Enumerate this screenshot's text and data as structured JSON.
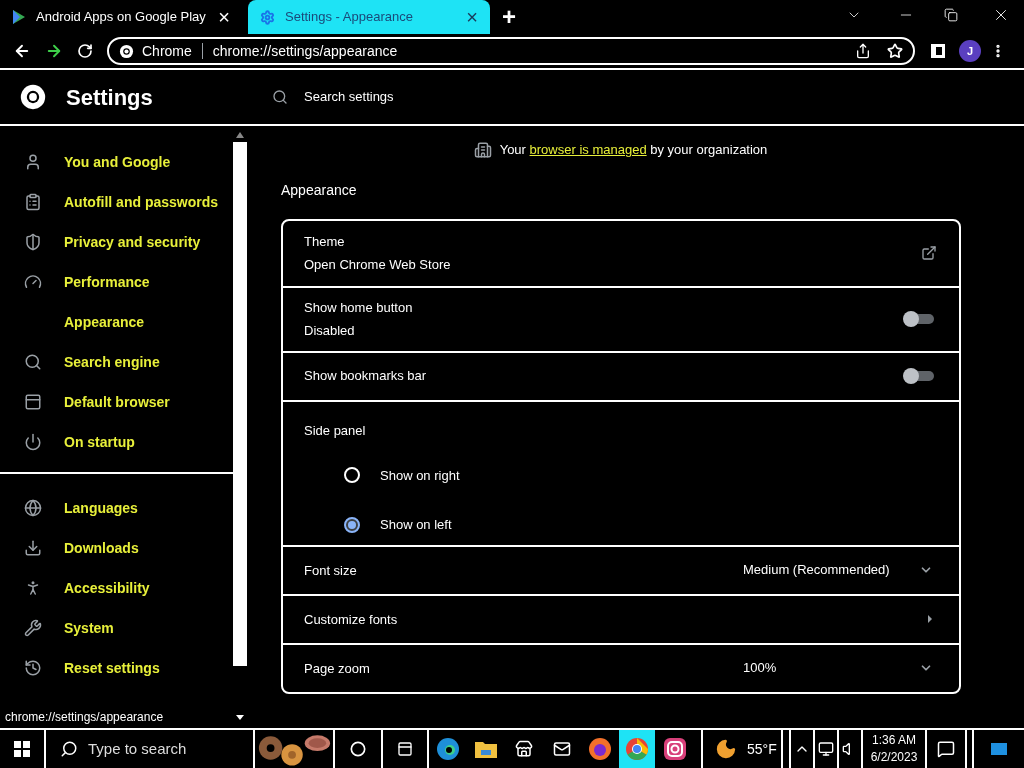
{
  "tabs": [
    {
      "label": "Android Apps on Google Play",
      "close": "×",
      "selected": false
    },
    {
      "label": "Settings - Appearance",
      "close": "×",
      "selected": true
    }
  ],
  "new_tab": "+",
  "address_bar": {
    "site": "Chrome",
    "url": "chrome://settings/appearance"
  },
  "profile": "J",
  "header": {
    "title": "Settings",
    "search_placeholder": "Search settings"
  },
  "sidebar": {
    "groups": [
      [
        {
          "label": "You and Google"
        },
        {
          "label": "Autofill and passwords"
        },
        {
          "label": "Privacy and security"
        },
        {
          "label": "Performance"
        },
        {
          "label": "Appearance"
        },
        {
          "label": "Search engine"
        },
        {
          "label": "Default browser"
        },
        {
          "label": "On startup"
        }
      ],
      [
        {
          "label": "Languages"
        },
        {
          "label": "Downloads"
        },
        {
          "label": "Accessibility"
        },
        {
          "label": "System"
        },
        {
          "label": "Reset settings"
        }
      ]
    ]
  },
  "managed_notice": {
    "before": "Your",
    "link": "browser is managed",
    "after": "by your organization"
  },
  "section_title": "Appearance",
  "rows": [
    {
      "kind": "link",
      "title": "Theme",
      "subtitle": "Open Chrome Web Store"
    },
    {
      "kind": "toggle",
      "title": "Show home button",
      "subtitle": "Disabled",
      "on": false
    },
    {
      "kind": "toggle",
      "title": "Show bookmarks bar",
      "on": false
    },
    {
      "kind": "radio",
      "title": "Side panel",
      "options": [
        {
          "label": "Show on right",
          "selected": false
        },
        {
          "label": "Show on left",
          "selected": true
        }
      ]
    },
    {
      "kind": "select",
      "title": "Font size",
      "value": "Medium (Recommended)"
    },
    {
      "kind": "arrow",
      "title": "Customize fonts"
    },
    {
      "kind": "select",
      "title": "Page zoom",
      "value": "100%"
    }
  ],
  "status_url": "chrome://settings/appearance",
  "taskbar": {
    "search_placeholder": "Type to search",
    "temperature": "55°F",
    "time": "1:36 AM",
    "date": "6/2/2023"
  }
}
